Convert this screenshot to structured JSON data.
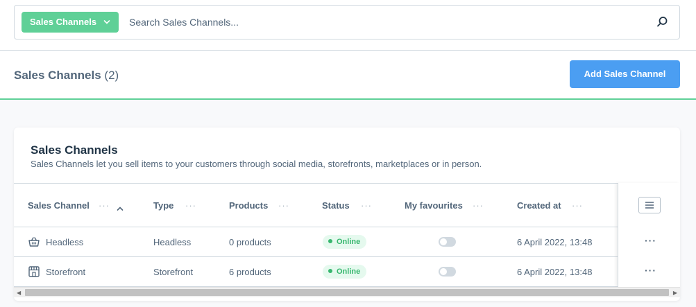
{
  "search": {
    "scope_label": "Sales Channels",
    "placeholder": "Search Sales Channels..."
  },
  "header": {
    "title": "Sales Channels",
    "count": "(2)",
    "add_button": "Add Sales Channel"
  },
  "card": {
    "title": "Sales Channels",
    "subtitle": "Sales Channels let you sell items to your customers through social media, storefronts, marketplaces or in person."
  },
  "table": {
    "columns": [
      {
        "label": "Sales Channel",
        "dots": "···"
      },
      {
        "label": "Type",
        "dots": "···"
      },
      {
        "label": "Products",
        "dots": "···"
      },
      {
        "label": "Status",
        "dots": "···"
      },
      {
        "label": "My favourites",
        "dots": "···"
      },
      {
        "label": "Created at",
        "dots": "···"
      }
    ],
    "rows": [
      {
        "name": "Headless",
        "icon": "basket-icon",
        "type": "Headless",
        "products": "0 products",
        "status": "Online",
        "favourite": false,
        "created": "6 April 2022, 13:48",
        "actions": "···"
      },
      {
        "name": "Storefront",
        "icon": "storefront-icon",
        "type": "Storefront",
        "products": "6 products",
        "status": "Online",
        "favourite": false,
        "created": "6 April 2022, 13:48",
        "actions": "···"
      }
    ]
  },
  "colors": {
    "accent_green": "#5fd097",
    "primary_blue": "#4b9ef2",
    "status_green": "#37b76e"
  }
}
